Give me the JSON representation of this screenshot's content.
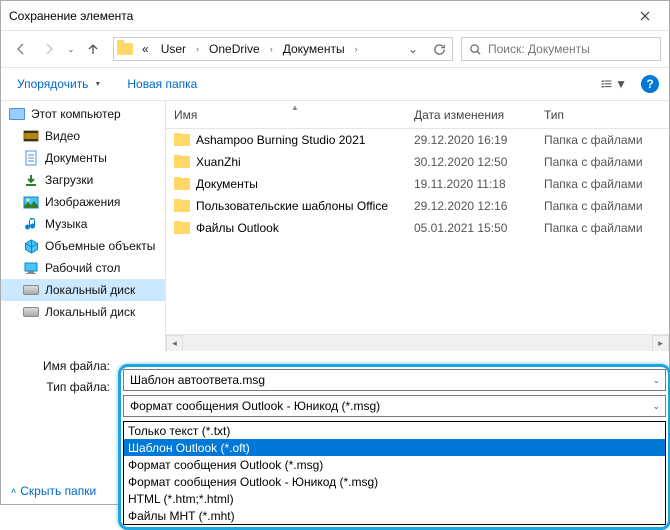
{
  "title": "Сохранение элемента",
  "breadcrumbs": {
    "root_icon": "«",
    "parts": [
      "User",
      "OneDrive",
      "Документы"
    ]
  },
  "search": {
    "placeholder": "Поиск: Документы"
  },
  "toolbar": {
    "organize": "Упорядочить",
    "newfolder": "Новая папка"
  },
  "columns": {
    "name": "Имя",
    "date": "Дата изменения",
    "type": "Тип"
  },
  "tree": [
    {
      "label": "Этот компьютер",
      "icon": "pc",
      "level": 0
    },
    {
      "label": "Видео",
      "icon": "video",
      "level": 1
    },
    {
      "label": "Документы",
      "icon": "doc",
      "level": 1
    },
    {
      "label": "Загрузки",
      "icon": "down",
      "level": 1
    },
    {
      "label": "Изображения",
      "icon": "img",
      "level": 1
    },
    {
      "label": "Музыка",
      "icon": "music",
      "level": 1
    },
    {
      "label": "Объемные объекты",
      "icon": "3d",
      "level": 1
    },
    {
      "label": "Рабочий стол",
      "icon": "desk",
      "level": 1
    },
    {
      "label": "Локальный диск",
      "icon": "disk",
      "level": 1,
      "selected": true
    },
    {
      "label": "Локальный диск",
      "icon": "disk",
      "level": 1
    }
  ],
  "files": [
    {
      "name": "Ashampoo Burning Studio 2021",
      "date": "29.12.2020 16:19",
      "type": "Папка с файлами"
    },
    {
      "name": "XuanZhi",
      "date": "30.12.2020 12:50",
      "type": "Папка с файлами"
    },
    {
      "name": "Документы",
      "date": "19.11.2020 11:18",
      "type": "Папка с файлами"
    },
    {
      "name": "Пользовательские шаблоны Office",
      "date": "29.12.2020 12:16",
      "type": "Папка с файлами"
    },
    {
      "name": "Файлы Outlook",
      "date": "05.01.2021 15:50",
      "type": "Папка с файлами"
    }
  ],
  "labels": {
    "filename": "Имя файла:",
    "filetype": "Тип файла:"
  },
  "filename_value": "Шаблон автоответа.msg",
  "filetype_value": "Формат сообщения Outlook - Юникод (*.msg)",
  "dropdown_items": [
    "Только текст (*.txt)",
    "Шаблон Outlook (*.oft)",
    "Формат сообщения Outlook (*.msg)",
    "Формат сообщения Outlook - Юникод (*.msg)",
    "HTML (*.htm;*.html)",
    "Файлы MHT (*.mht)"
  ],
  "dropdown_selected_index": 1,
  "footer": {
    "hide_folders": "Скрыть папки"
  }
}
